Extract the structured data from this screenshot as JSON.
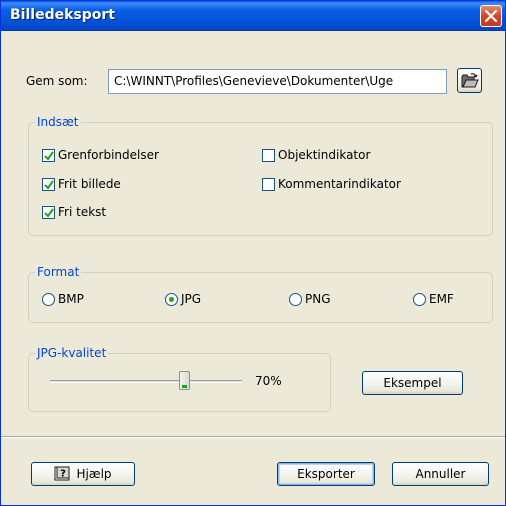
{
  "window": {
    "title": "Billedeksport"
  },
  "save": {
    "label": "Gem som:",
    "path_value": "C:\\WINNT\\Profiles\\Genevieve\\Dokumenter\\Uge"
  },
  "insert_group": {
    "legend": "Indsæt",
    "options": [
      {
        "label": "Grenforbindelser",
        "checked": true
      },
      {
        "label": "Frit billede",
        "checked": true
      },
      {
        "label": "Fri tekst",
        "checked": true
      },
      {
        "label": "Objektindikator",
        "checked": false
      },
      {
        "label": "Kommentarindikator",
        "checked": false
      }
    ]
  },
  "format_group": {
    "legend": "Format",
    "options": [
      {
        "label": "BMP",
        "selected": false
      },
      {
        "label": "JPG",
        "selected": true
      },
      {
        "label": "PNG",
        "selected": false
      },
      {
        "label": "EMF",
        "selected": false
      }
    ]
  },
  "quality_group": {
    "legend": "JPG-kvalitet",
    "value_text": "70%",
    "value": 70,
    "example_button": "Eksempel"
  },
  "footer": {
    "help_button": "Hjælp",
    "export_button": "Eksporter",
    "cancel_button": "Annuller"
  },
  "colors": {
    "titlebar": "#0a5fe8",
    "group_legend": "#0046d5",
    "checkmark": "#21a121",
    "close_button": "#d4462a"
  },
  "icons": {
    "close": "close-icon",
    "browse": "open-folder-icon",
    "help": "help-book-icon",
    "check": "checkmark-icon"
  }
}
